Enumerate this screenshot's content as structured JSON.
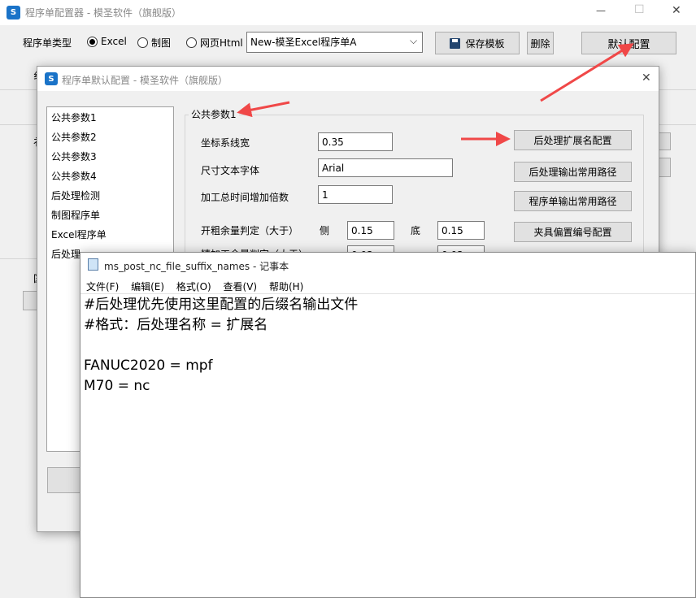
{
  "main_window": {
    "logo_text": "S",
    "title": "程序单配置器 - 模圣软件（旗舰版）",
    "controls": {
      "minimize": "—",
      "maximize": "☐",
      "close": "✕"
    },
    "type_label": "程序单类型",
    "radio_options": [
      {
        "label": "Excel",
        "selected": true
      },
      {
        "label": "制图",
        "selected": false
      },
      {
        "label": "网页Html",
        "selected": false
      }
    ],
    "template_select": {
      "value": "New-模圣Excel程序单A"
    },
    "save_template_label": "保存模板",
    "delete_label": "删除",
    "default_config_label": "默认配置",
    "partial_label_1": "纟",
    "partial_label_2": "衤",
    "partial_label_3": "国"
  },
  "dialog": {
    "logo_text": "S",
    "title": "程序单默认配置 - 模圣软件（旗舰版）",
    "close": "✕",
    "list_items": [
      "公共参数1",
      "公共参数2",
      "公共参数3",
      "公共参数4",
      "后处理检测",
      "制图程序单",
      "Excel程序单",
      "后处理"
    ],
    "group_title": "公共参数1",
    "fields": [
      {
        "label": "坐标系线宽",
        "value": "0.35"
      },
      {
        "label": "尺寸文本字体",
        "value": "Arial"
      },
      {
        "label": "加工总时间增加倍数",
        "value": "1"
      }
    ],
    "rough_label": "开粗余量判定（大于）",
    "side_label": "侧",
    "side_value": "0.15",
    "bottom_label": "底",
    "bottom_value": "0.15",
    "finish_label_partial": "精加工余量判定（大于）",
    "finish_side_partial": "0.03",
    "finish_bottom_partial": "0.03",
    "right_buttons": [
      "后处理扩展名配置",
      "后处理输出常用路径",
      "程序单输出常用路径",
      "夹具偏置编号配置"
    ]
  },
  "notepad": {
    "title": "ms_post_nc_file_suffix_names - 记事本",
    "menu": [
      "文件(F)",
      "编辑(E)",
      "格式(O)",
      "查看(V)",
      "帮助(H)"
    ],
    "lines": [
      "#后处理优先使用这里配置的后缀名输出文件",
      "#格式：后处理名称 = 扩展名",
      "",
      "FANUC2020 = mpf",
      "M70 = nc"
    ]
  },
  "colors": {
    "accent_red": "#f04848",
    "logo_blue": "#1a73c8",
    "selection_bg": "#ffffff"
  }
}
